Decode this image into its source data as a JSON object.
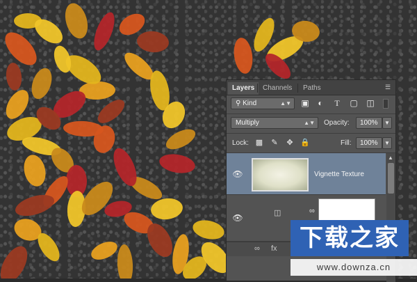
{
  "panel": {
    "tabs": [
      "Layers",
      "Channels",
      "Paths"
    ],
    "active_tab": "Layers",
    "filter": {
      "kind_label": "Kind",
      "icons": [
        "image-filter-icon",
        "adjustment-filter-icon",
        "type-filter-icon",
        "shape-filter-icon",
        "smart-object-filter-icon"
      ]
    },
    "blend_mode": "Multiply",
    "opacity_label": "Opacity:",
    "opacity_value": "100%",
    "lock_label": "Lock:",
    "lock_icons": [
      "lock-transparent-pixels-icon",
      "lock-image-pixels-icon",
      "lock-position-icon",
      "lock-all-icon"
    ],
    "fill_label": "Fill:",
    "fill_value": "100%",
    "layers": [
      {
        "name": "Vignette Texture",
        "visible": true,
        "selected": true
      },
      {
        "name": "",
        "visible": true,
        "selected": false
      }
    ]
  },
  "watermark": {
    "logo_text": "下载之家",
    "url": "www.downza.cn"
  },
  "colors": {
    "panel_bg": "#535353",
    "selected_layer": "#6f8299",
    "watermark_blue": "#2f62b4"
  }
}
